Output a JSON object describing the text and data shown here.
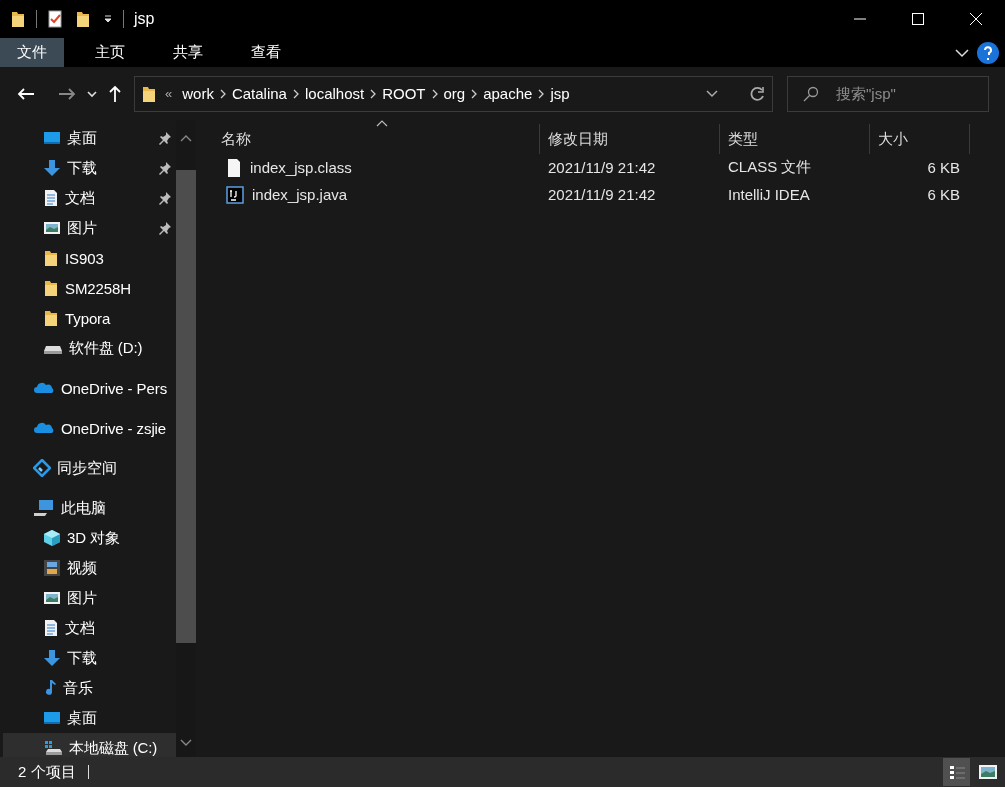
{
  "window": {
    "title": "jsp",
    "quick_toolbar": [
      {
        "kind": "folder"
      },
      {
        "kind": "properties"
      },
      {
        "kind": "newfolder"
      }
    ]
  },
  "ribbon": {
    "tabs": [
      {
        "label": "文件",
        "selected": true
      },
      {
        "label": "主页",
        "selected": false
      },
      {
        "label": "共享",
        "selected": false
      },
      {
        "label": "查看",
        "selected": false
      }
    ]
  },
  "address_bar": {
    "overflow_mark": "«",
    "crumbs": [
      "work",
      "Catalina",
      "localhost",
      "ROOT",
      "org",
      "apache",
      "jsp"
    ]
  },
  "search": {
    "placeholder": "搜索\"jsp\""
  },
  "sidebar": {
    "quick_access": [
      {
        "label": "桌面",
        "kind": "desktop",
        "pinned": true,
        "selected": false
      },
      {
        "label": "下载",
        "kind": "download",
        "pinned": true,
        "selected": false
      },
      {
        "label": "文档",
        "kind": "document",
        "pinned": true,
        "selected": false
      },
      {
        "label": "图片",
        "kind": "pictures",
        "pinned": true,
        "selected": false
      },
      {
        "label": "IS903",
        "kind": "folder",
        "pinned": false,
        "selected": false
      },
      {
        "label": "SM2258H",
        "kind": "folder",
        "pinned": false,
        "selected": false
      },
      {
        "label": "Typora",
        "kind": "folder",
        "pinned": false,
        "selected": false
      },
      {
        "label": "软件盘 (D:)",
        "kind": "drive",
        "pinned": false,
        "selected": false
      }
    ],
    "items": [
      {
        "label": "OneDrive - Pers",
        "kind": "onedrive",
        "selected": false
      },
      {
        "label": "OneDrive - zsjie",
        "kind": "onedrive",
        "selected": false
      },
      {
        "label": "同步空间",
        "kind": "sync",
        "selected": false
      },
      {
        "label": "此电脑",
        "kind": "pc",
        "selected": false,
        "children": [
          {
            "label": "3D 对象",
            "kind": "cube",
            "selected": false
          },
          {
            "label": "视频",
            "kind": "video",
            "selected": false
          },
          {
            "label": "图片",
            "kind": "pictures",
            "selected": false
          },
          {
            "label": "文档",
            "kind": "document",
            "selected": false
          },
          {
            "label": "下载",
            "kind": "download",
            "selected": false
          },
          {
            "label": "音乐",
            "kind": "music",
            "selected": false
          },
          {
            "label": "桌面",
            "kind": "desktop",
            "selected": false
          },
          {
            "label": "本地磁盘 (C:)",
            "kind": "windrive",
            "selected": true
          }
        ]
      }
    ]
  },
  "table": {
    "columns": [
      {
        "label": "名称",
        "sorted": true
      },
      {
        "label": "修改日期",
        "sorted": false
      },
      {
        "label": "类型",
        "sorted": false
      },
      {
        "label": "大小",
        "sorted": false
      }
    ],
    "rows": [
      {
        "kind": "file",
        "name": "index_jsp.class",
        "modified": "2021/11/9 21:42",
        "type": "CLASS 文件",
        "size": "6 KB"
      },
      {
        "kind": "intellij",
        "name": "index_jsp.java",
        "modified": "2021/11/9 21:42",
        "type": "IntelliJ IDEA",
        "size": "6 KB"
      }
    ]
  },
  "status_bar": {
    "count": "2 个项目",
    "views": [
      {
        "kind": "details",
        "selected": true
      },
      {
        "kind": "largeicons",
        "selected": false
      }
    ]
  }
}
